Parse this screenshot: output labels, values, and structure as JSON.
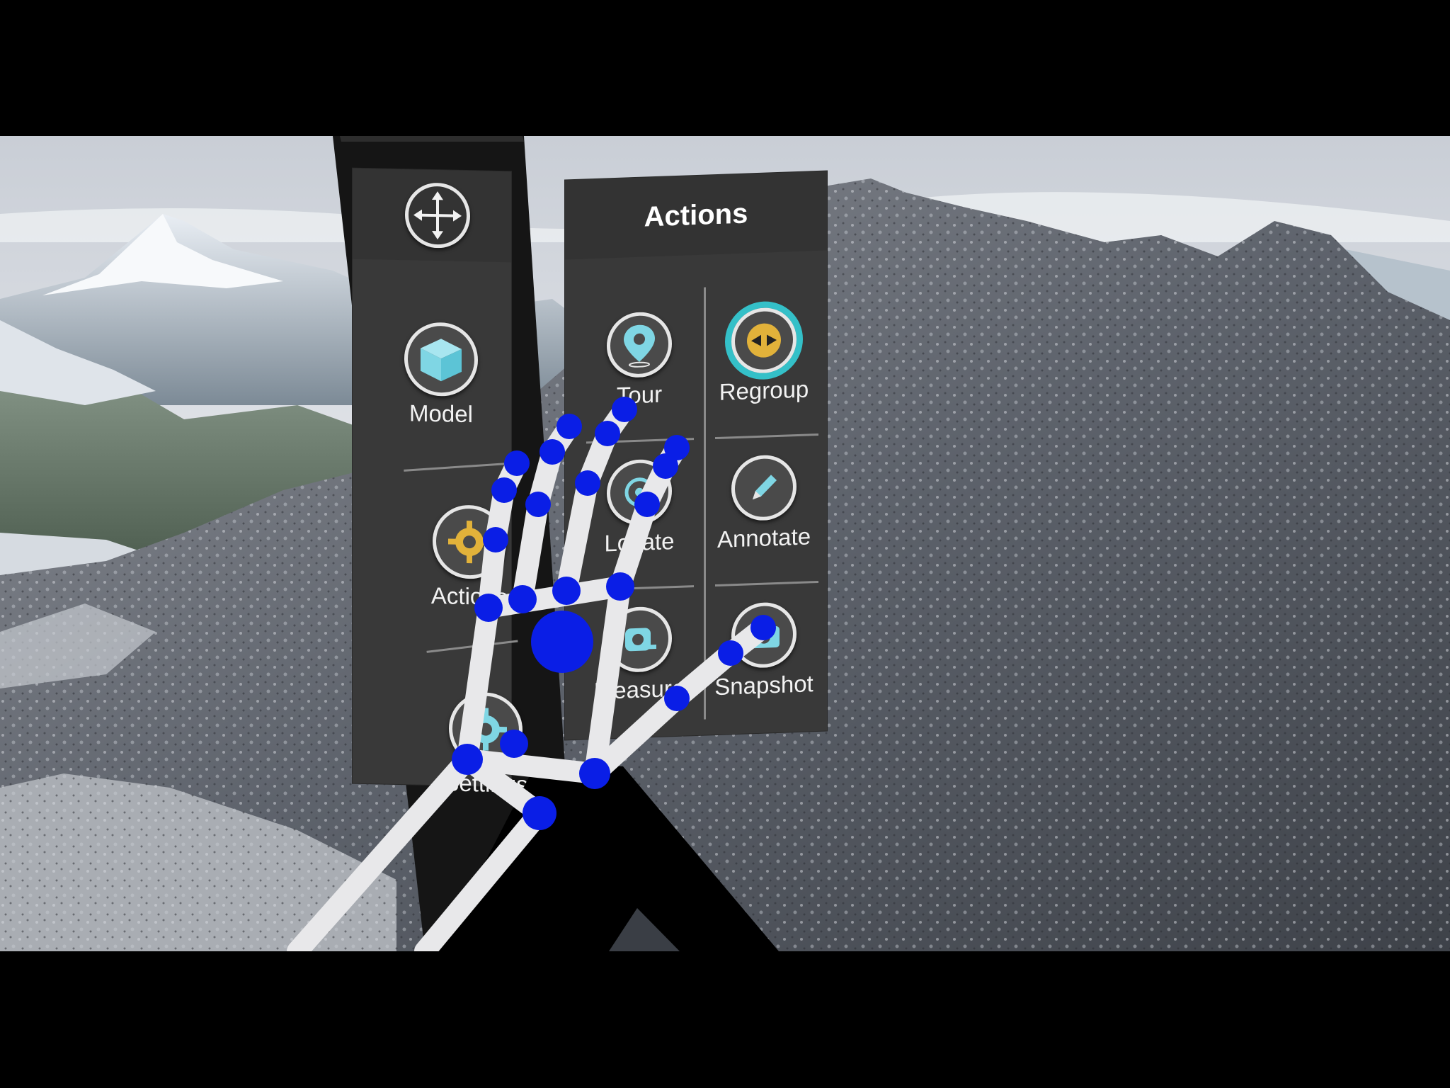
{
  "colors": {
    "panel": "#3a3a3a",
    "panel_header": "#333333",
    "icon_cyan": "#7fd6e4",
    "highlight_ring": "#34c0c8",
    "hand_joint": "#0a1ee6",
    "hand_bone": "#e8e8ea"
  },
  "left_menu": {
    "move_icon": "move-arrows-icon",
    "items": [
      {
        "label": "Model",
        "icon": "cube-icon"
      },
      {
        "label": "Actions",
        "icon": "gear-icon"
      },
      {
        "label": "Settings",
        "icon": "settings-icon"
      }
    ]
  },
  "actions_menu": {
    "title": "Actions",
    "items": [
      {
        "label": "Tour",
        "icon": "location-pin-icon"
      },
      {
        "label": "Regroup",
        "icon": "regroup-icon",
        "highlighted": true
      },
      {
        "label": "Locate",
        "icon": "locate-icon"
      },
      {
        "label": "Annotate",
        "icon": "pencil-icon"
      },
      {
        "label": "Measure",
        "icon": "tape-measure-icon"
      },
      {
        "label": "Snapshot",
        "icon": "camera-icon"
      }
    ]
  }
}
